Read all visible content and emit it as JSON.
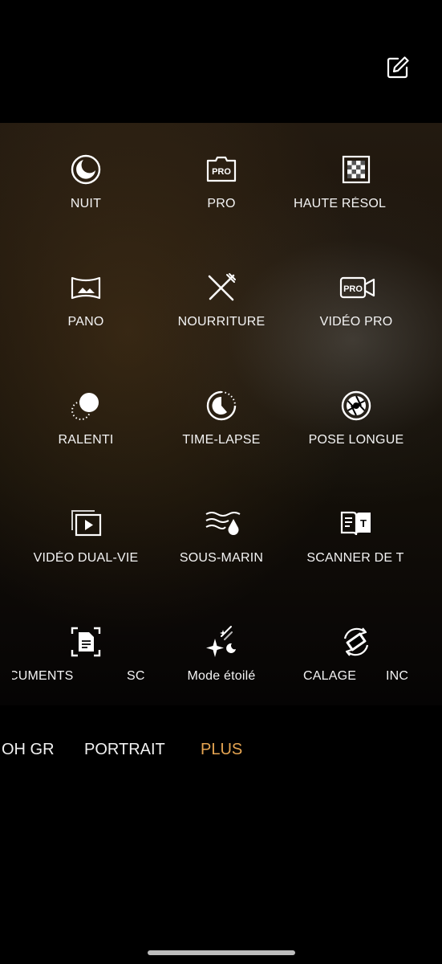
{
  "topbar": {
    "edit_icon": "edit-icon"
  },
  "grid": {
    "row1": {
      "c1": "NUIT",
      "c2": "PRO",
      "c3": "HAUTE RÉSOL"
    },
    "row2": {
      "c1": "PANO",
      "c2": "NOURRITURE",
      "c3": "VIDÉO PRO"
    },
    "row3": {
      "c1": "RALENTI",
      "c2": "TIME-LAPSE",
      "c3": "POSE LONGUE"
    },
    "row4": {
      "c1": "VIDÉO DUAL-VIE",
      "c2": "SOUS-MARIN",
      "c3": "SCANNER DE T"
    },
    "row5": {
      "c1a": "CUMENTS",
      "c1b": "SC",
      "c2": "Mode étoilé",
      "c3a": "CALAGE",
      "c3b": "INC"
    }
  },
  "modes": {
    "left": "OH GR",
    "portrait": "PORTRAIT",
    "plus": "PLUS"
  },
  "colors": {
    "active_mode": "#e6a552",
    "text": "#f4f4f4",
    "background": "#000000"
  }
}
